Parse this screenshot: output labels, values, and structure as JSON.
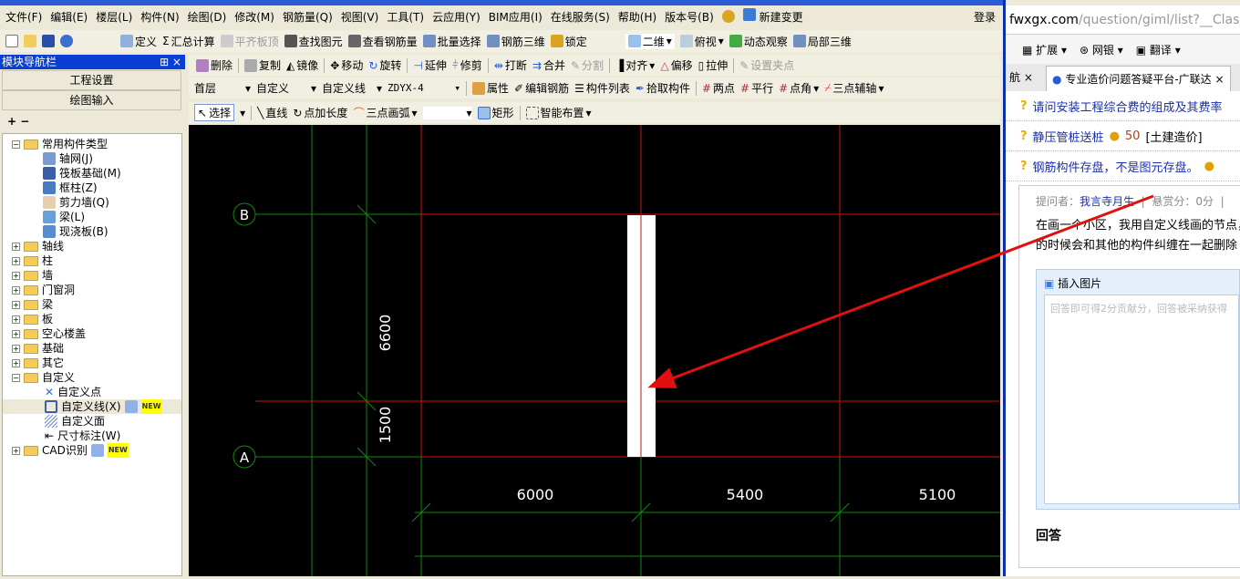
{
  "menu": [
    "文件(F)",
    "编辑(E)",
    "楼层(L)",
    "构件(N)",
    "绘图(D)",
    "修改(M)",
    "钢筋量(Q)",
    "视图(V)",
    "工具(T)",
    "云应用(Y)",
    "BIM应用(I)",
    "在线服务(S)",
    "帮助(H)",
    "版本号(B)",
    "新建变更"
  ],
  "login": "登录",
  "toolbar1": [
    "定义",
    "汇总计算",
    "平齐板顶",
    "查找图元",
    "查看钢筋量",
    "批量选择",
    "钢筋三维",
    "锁定",
    "二维",
    "俯视",
    "动态观察",
    "局部三维"
  ],
  "toolbar2": [
    "删除",
    "复制",
    "镜像",
    "移动",
    "旋转",
    "延伸",
    "修剪",
    "打断",
    "合并",
    "分割",
    "对齐",
    "偏移",
    "拉伸",
    "设置夹点"
  ],
  "toolbar3": {
    "floor": "首层",
    "category": "自定义",
    "type": "自定义线",
    "component": "ZDYX-4",
    "buttons": [
      "属性",
      "编辑钢筋",
      "构件列表",
      "拾取构件",
      "两点",
      "平行",
      "点角",
      "三点辅轴"
    ]
  },
  "toolbar4": [
    "选择",
    "直线",
    "点加长度",
    "三点画弧",
    "矩形",
    "智能布置"
  ],
  "nav": {
    "title": "模块导航栏",
    "buttons": [
      "工程设置",
      "绘图输入"
    ]
  },
  "tree": {
    "common": {
      "label": "常用构件类型",
      "children": [
        "轴网(J)",
        "筏板基础(M)",
        "框柱(Z)",
        "剪力墙(Q)",
        "梁(L)",
        "现浇板(B)"
      ]
    },
    "folders": [
      "轴线",
      "柱",
      "墙",
      "门窗洞",
      "梁",
      "板",
      "空心楼盖",
      "基础",
      "其它"
    ],
    "custom": {
      "label": "自定义",
      "children": [
        "自定义点",
        "自定义线(X)",
        "自定义面",
        "尺寸标注(W)"
      ]
    },
    "cad": "CAD识别",
    "new_badge": "NEW"
  },
  "canvas": {
    "axes": [
      "B",
      "A"
    ],
    "vertical_dims": [
      "6600",
      "1500"
    ],
    "horizontal_dims": [
      "6000",
      "5400",
      "5100"
    ]
  },
  "browser": {
    "url_host": "fwxgx.com",
    "url_path": "/question/giml/list?__Clas",
    "toolbar": [
      "扩展",
      "网银",
      "翻译"
    ],
    "tab_prev": "航",
    "tab_active": "专业造价问题答疑平台-广联达",
    "questions": [
      {
        "title": "请问安装工程综合费的组成及其费率"
      },
      {
        "title": "静压管桩送桩",
        "points": "50",
        "tag": "[土建造价]"
      },
      {
        "title": "钢筋构件存盘，不是图元存盘。"
      }
    ],
    "asker_label": "提问者：",
    "asker": "我言寺月生",
    "reward": "悬赏分：0分",
    "body": "在画一个小区，我用自定义线画的节点，的时候会和其他的构件纠缠在一起删除",
    "insert_image": "插入图片",
    "placeholder": "回答即可得2分贡献分，回答被采纳获得",
    "answer_heading": "回答"
  }
}
